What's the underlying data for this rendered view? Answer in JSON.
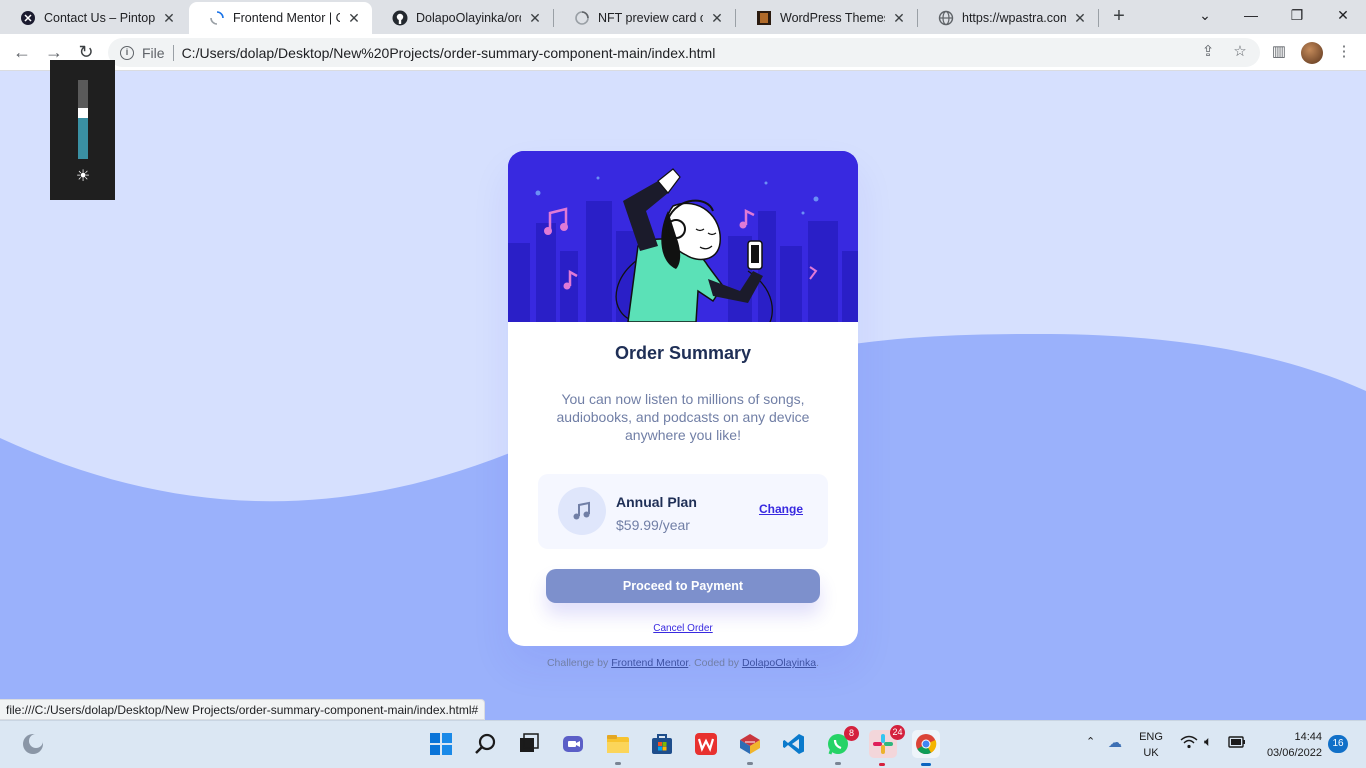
{
  "browser": {
    "tabs": [
      {
        "label": "Contact Us – Pintop Te",
        "icon": "pintop-icon"
      },
      {
        "label": "Frontend Mentor | Ord",
        "icon": "loading-icon"
      },
      {
        "label": "DolapoOlayinka/order",
        "icon": "github-icon"
      },
      {
        "label": "NFT preview card com",
        "icon": "loading-icon"
      },
      {
        "label": "WordPress Themes &",
        "icon": "wordpress-themes-icon"
      },
      {
        "label": "https://wpastra.com/s",
        "icon": "globe-icon"
      }
    ],
    "new_tab_symbol": "+",
    "address": {
      "scheme_label": "File",
      "url": "C:/Users/dolap/Desktop/New%20Projects/order-summary-component-main/index.html"
    },
    "status_url": "file:///C:/Users/dolap/Desktop/New Projects/order-summary-component-main/index.html#"
  },
  "brightness": {
    "level": 0.6,
    "icon": "sun-icon"
  },
  "card": {
    "title": "Order Summary",
    "description": "You can now listen to millions of songs, audiobooks, and podcasts on any device anywhere you like!",
    "plan": {
      "name": "Annual Plan",
      "price": "$59.99/year",
      "change_label": "Change",
      "icon": "music-note-icon"
    },
    "pay_label": "Proceed to Payment",
    "cancel_label": "Cancel Order"
  },
  "attribution": {
    "prefix": "Challenge by",
    "link1": "Frontend Mentor",
    "middle": ". Coded by",
    "link2": "DolapoOlayinka",
    "suffix": "."
  },
  "taskbar": {
    "apps": [
      {
        "name": "start",
        "badge": ""
      },
      {
        "name": "search",
        "badge": ""
      },
      {
        "name": "task-view",
        "badge": ""
      },
      {
        "name": "teams-chat",
        "badge": ""
      },
      {
        "name": "file-explorer",
        "badge": ""
      },
      {
        "name": "microsoft-store",
        "badge": ""
      },
      {
        "name": "wps-office",
        "badge": ""
      },
      {
        "name": "sketchup",
        "badge": ""
      },
      {
        "name": "vs-code",
        "badge": ""
      },
      {
        "name": "whatsapp",
        "badge": "8"
      },
      {
        "name": "slack",
        "badge": "24"
      },
      {
        "name": "chrome",
        "badge": ""
      }
    ],
    "language": {
      "line1": "ENG",
      "line2": "UK"
    },
    "time": "14:44",
    "date": "03/06/2022",
    "notifications": "16"
  },
  "colors": {
    "page_bg": "#d6e0fe",
    "wave": "#9ab1fb",
    "hero_bg": "#3829e0",
    "title": "#1f2f56",
    "muted": "#717fa6",
    "button": "#7d90cc"
  }
}
